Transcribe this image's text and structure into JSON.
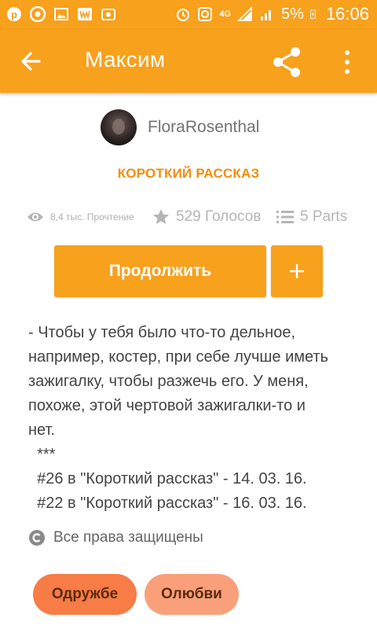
{
  "status_bar": {
    "time": "16:06",
    "battery_percent": "5%",
    "network": "4G",
    "left_icons": [
      "pinterest-icon",
      "chrome-icon",
      "image-icon",
      "wattpad-icon",
      "photo-icon"
    ],
    "right_icons": [
      "alarm-icon",
      "data-saver-icon",
      "signal-icon",
      "battery-charging-icon"
    ]
  },
  "app_bar": {
    "title": "Максим",
    "icons": [
      "back-arrow-icon",
      "share-icon",
      "more-vert-icon"
    ]
  },
  "author": {
    "name": "FloraRosenthal"
  },
  "category": "КОРОТКИЙ РАССКАЗ",
  "stats": {
    "reads": "8,4 тыс. Прочтение",
    "votes": "529 Голосов",
    "parts": "5 Parts"
  },
  "actions": {
    "continue_label": "Продолжить",
    "add_label": "+"
  },
  "description": {
    "lines": [
      "- Чтобы у тебя было что-то дельное,",
      "например, костер, при себе лучше иметь",
      "зажигалку, чтобы разжечь его. У меня,",
      "похоже, этой чертовой зажигалки-то и",
      "нет.",
      "  ***",
      "  #26 в \"Короткий рассказ\" - 14. 03. 16.",
      "  #22 в \"Короткий рассказ\" - 16. 03. 16."
    ]
  },
  "copyright": "Все права защищены",
  "tags": [
    "Одружбе",
    "Олюбви"
  ],
  "colors": {
    "accent": "#f7a11d",
    "category": "#f58c0b",
    "tag_primary": "#f77c45",
    "tag_secondary": "#f9a07a"
  }
}
